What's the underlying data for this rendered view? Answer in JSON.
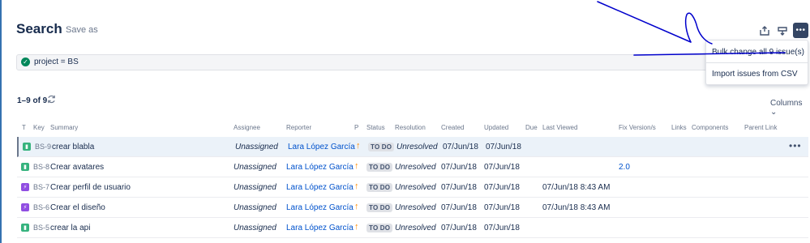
{
  "header": {
    "title": "Search",
    "save_as": "Save as"
  },
  "toolbar": {
    "share_icon": "share-icon",
    "export_icon": "export-icon",
    "more_icon": "more-icon"
  },
  "more_menu": {
    "items": [
      "Bulk change all 9 issue(s)",
      "Import issues from CSV"
    ]
  },
  "query": {
    "text": "project = BS",
    "status_icon": "check-icon",
    "valid_color": "#00875a"
  },
  "results": {
    "count_text": "1–9 of 9",
    "columns_label": "Columns"
  },
  "table": {
    "headers": {
      "type": "T",
      "key": "Key",
      "summary": "Summary",
      "assignee": "Assignee",
      "reporter": "Reporter",
      "priority": "P",
      "status": "Status",
      "resolution": "Resolution",
      "created": "Created",
      "updated": "Updated",
      "due": "Due",
      "last_viewed": "Last Viewed",
      "fix_version": "Fix Version/s",
      "links": "Links",
      "components": "Components",
      "parent_link": "Parent Link"
    },
    "rows": [
      {
        "type": "story",
        "key": "BS-9",
        "summary": "crear blabla",
        "assignee": "Unassigned",
        "reporter": "Lara López García",
        "priority": "↑",
        "status": "TO DO",
        "resolution": "Unresolved",
        "created": "07/Jun/18",
        "updated": "07/Jun/18",
        "last_viewed": "",
        "fix_version": "",
        "actions": "•••"
      },
      {
        "type": "story",
        "key": "BS-8",
        "summary": "Crear avatares",
        "assignee": "Unassigned",
        "reporter": "Lara López García",
        "priority": "↑",
        "status": "TO DO",
        "resolution": "Unresolved",
        "created": "07/Jun/18",
        "updated": "07/Jun/18",
        "last_viewed": "",
        "fix_version": "2.0",
        "actions": ""
      },
      {
        "type": "epic",
        "key": "BS-7",
        "summary": "Crear perfil de usuario",
        "assignee": "Unassigned",
        "reporter": "Lara López García",
        "priority": "↑",
        "status": "TO DO",
        "resolution": "Unresolved",
        "created": "07/Jun/18",
        "updated": "07/Jun/18",
        "last_viewed": "07/Jun/18 8:43 AM",
        "fix_version": "",
        "actions": ""
      },
      {
        "type": "epic",
        "key": "BS-6",
        "summary": "Crear el diseño",
        "assignee": "Unassigned",
        "reporter": "Lara López García",
        "priority": "↑",
        "status": "TO DO",
        "resolution": "Unresolved",
        "created": "07/Jun/18",
        "updated": "07/Jun/18",
        "last_viewed": "07/Jun/18 8:43 AM",
        "fix_version": "",
        "actions": ""
      },
      {
        "type": "story",
        "key": "BS-5",
        "summary": "crear la api",
        "assignee": "Unassigned",
        "reporter": "Lara López García",
        "priority": "↑",
        "status": "TO DO",
        "resolution": "Unresolved",
        "created": "07/Jun/18",
        "updated": "07/Jun/18",
        "last_viewed": "",
        "fix_version": "",
        "actions": ""
      }
    ]
  },
  "colors": {
    "story": "#36b37e",
    "epic": "#904ee2",
    "link": "#0052cc",
    "priority": "#ff8b00",
    "annotation": "#0000cc"
  }
}
